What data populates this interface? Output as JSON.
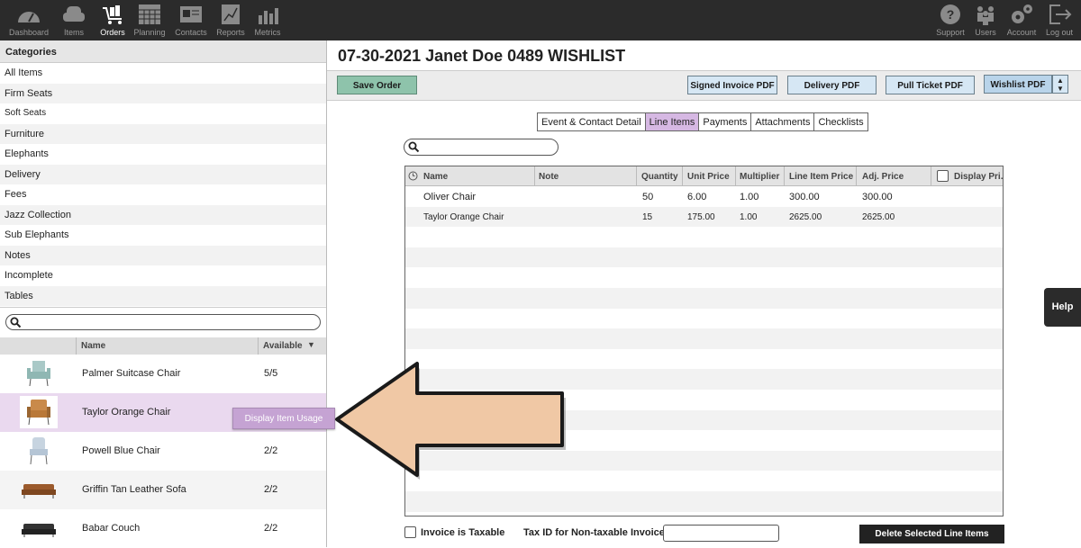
{
  "nav": {
    "left": [
      {
        "label": "Dashboard",
        "icon": "gauge-icon"
      },
      {
        "label": "Items",
        "icon": "armchair-icon"
      },
      {
        "label": "Orders",
        "icon": "cart-icon",
        "active": true
      },
      {
        "label": "Planning",
        "icon": "calendar-icon"
      },
      {
        "label": "Contacts",
        "icon": "contact-card-icon"
      },
      {
        "label": "Reports",
        "icon": "line-chart-icon"
      },
      {
        "label": "Metrics",
        "icon": "bar-chart-icon"
      }
    ],
    "right": [
      {
        "label": "Support",
        "icon": "question-icon"
      },
      {
        "label": "Users",
        "icon": "users-icon"
      },
      {
        "label": "Account",
        "icon": "gears-icon"
      },
      {
        "label": "Log out",
        "icon": "logout-icon"
      }
    ]
  },
  "sidebar": {
    "title": "Categories",
    "categories": [
      "All Items",
      "Firm Seats",
      "Soft Seats",
      "Furniture",
      "Elephants",
      "Delivery",
      "Fees",
      "Jazz Collection",
      "Sub Elephants",
      "Notes",
      "Incomplete",
      "Tables"
    ],
    "columns": {
      "name": "Name",
      "available": "Available"
    },
    "products": [
      {
        "name": "Palmer Suitcase Chair",
        "available": "5/5"
      },
      {
        "name": "Taylor Orange Chair",
        "available": ""
      },
      {
        "name": "Powell Blue Chair",
        "available": "2/2"
      },
      {
        "name": "Griffin Tan Leather Sofa",
        "available": "2/2"
      },
      {
        "name": "Babar Couch",
        "available": "2/2"
      }
    ],
    "usage_button": "Display Item Usage"
  },
  "main": {
    "title": "07-30-2021 Janet Doe 0489 WISHLIST",
    "save_button": "Save Order",
    "buttons": {
      "signed_invoice": "Signed Invoice PDF",
      "delivery": "Delivery PDF",
      "pull_ticket": "Pull Ticket PDF",
      "wishlist": "Wishlist PDF"
    },
    "tabs": [
      "Event & Contact Detail",
      "Line Items",
      "Payments",
      "Attachments",
      "Checklists"
    ],
    "active_tab": "Line Items",
    "grid": {
      "columns": {
        "name": "Name",
        "note": "Note",
        "quantity": "Quantity",
        "unit_price": "Unit Price",
        "multiplier": "Multiplier",
        "line_item_price": "Line Item Price",
        "adj_price": "Adj. Price",
        "display": "Display Pri..."
      },
      "rows": [
        {
          "name": "Oliver Chair",
          "note": "",
          "quantity": "50",
          "unit_price": "6.00",
          "multiplier": "1.00",
          "line_item_price": "300.00",
          "adj_price": "300.00"
        },
        {
          "name": "Taylor Orange Chair",
          "note": "",
          "quantity": "15",
          "unit_price": "175.00",
          "multiplier": "1.00",
          "line_item_price": "2625.00",
          "adj_price": "2625.00"
        }
      ]
    },
    "footer": {
      "taxable_label": "Invoice is Taxable",
      "tax_id_label": "Tax ID for Non-taxable Invoice:",
      "tax_id_value": "",
      "delete_button": "Delete Selected Line Items"
    }
  },
  "help": "Help",
  "colors": {
    "topbar": "#2b2b2b",
    "save": "#8ec3ab",
    "active_tab": "#d6b8e3",
    "arrow": "#f0c8a5"
  }
}
